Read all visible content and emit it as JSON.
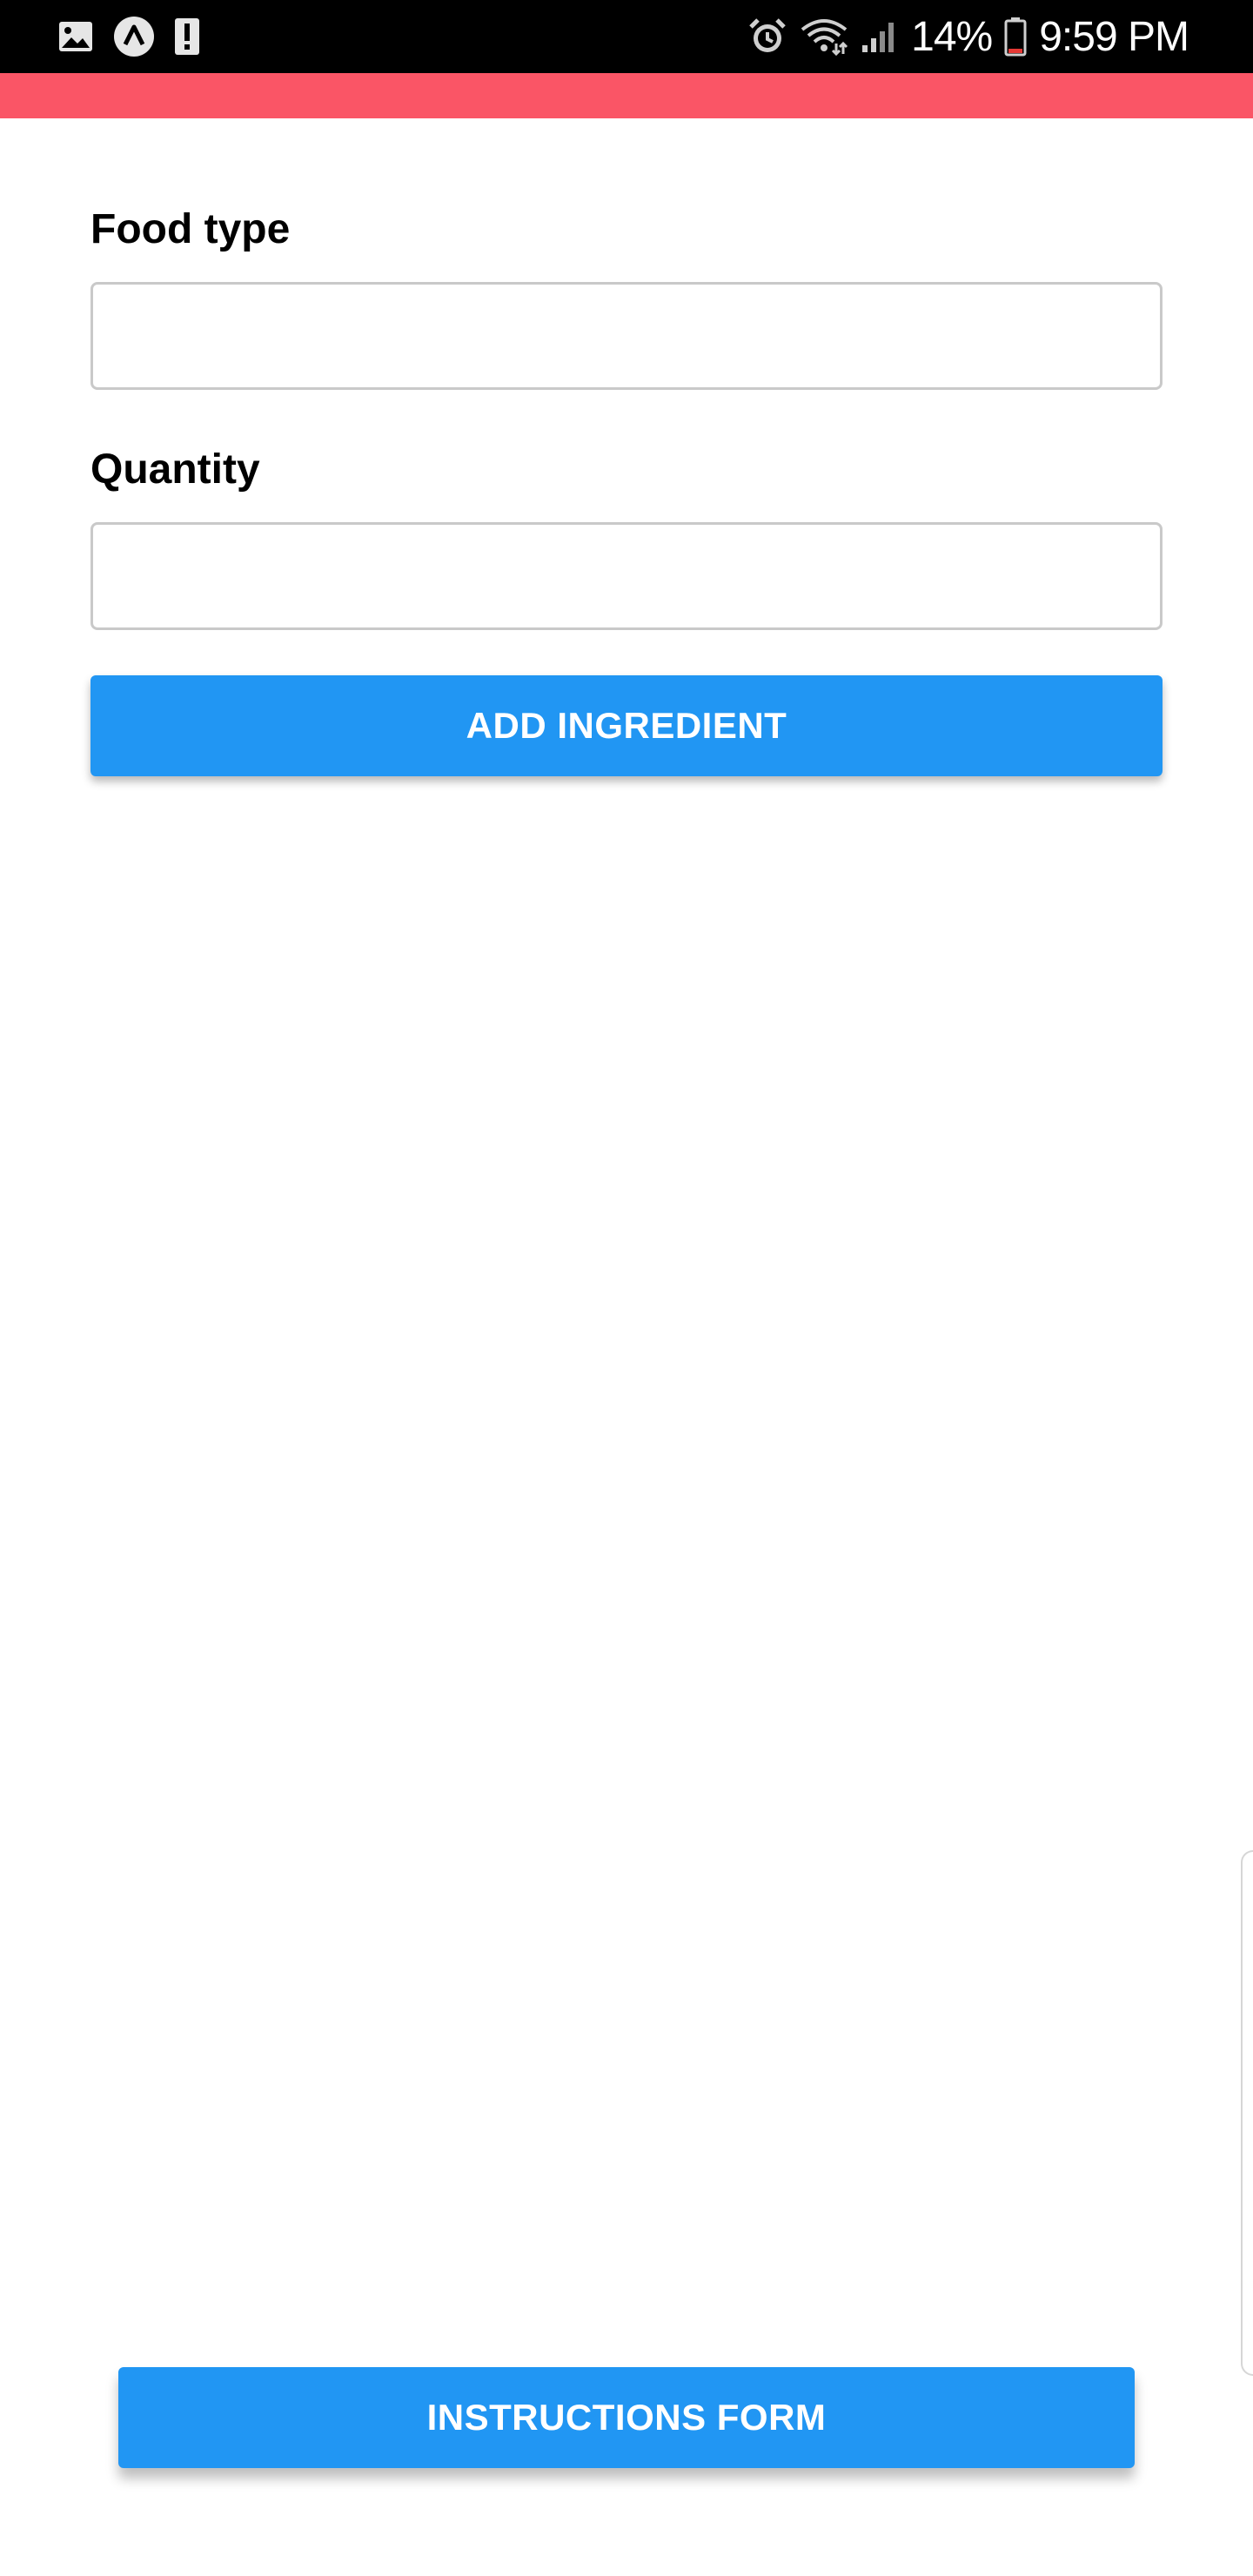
{
  "status_bar": {
    "left_icons": [
      "image-icon",
      "app-icon",
      "alert-icon"
    ],
    "right_icons": [
      "alarm-icon",
      "wifi-icon",
      "signal-icon",
      "battery-icon"
    ],
    "battery_percent": "14%",
    "time": "9:59 PM",
    "battery_level": 0.14
  },
  "colors": {
    "accent": "#fa5566",
    "button": "#2196f3",
    "status_bar": "#000000"
  },
  "form": {
    "food_type": {
      "label": "Food type",
      "value": "",
      "placeholder": ""
    },
    "quantity": {
      "label": "Quantity",
      "value": "",
      "placeholder": ""
    },
    "add_button_label": "ADD INGREDIENT"
  },
  "footer": {
    "instructions_button_label": "INSTRUCTIONS FORM"
  }
}
